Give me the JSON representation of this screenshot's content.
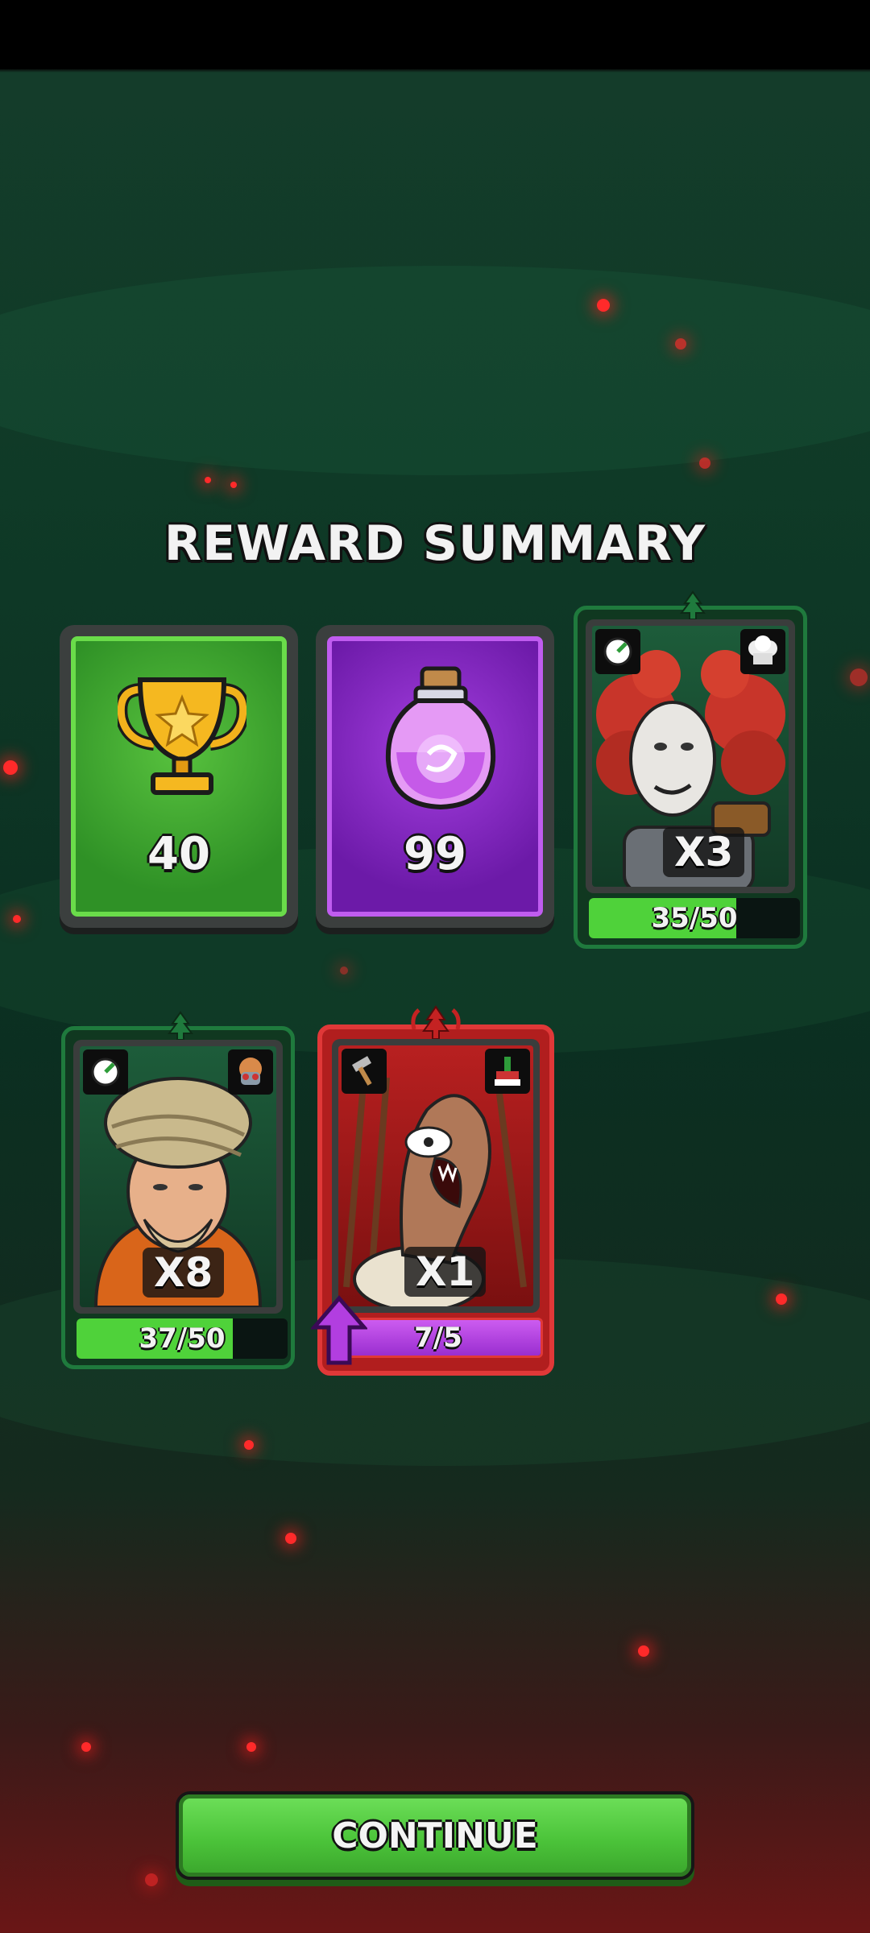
{
  "title": "REWARD SUMMARY",
  "rewards": [
    {
      "kind": "trophy",
      "icon": "trophy-icon",
      "amount": "40",
      "color": "#3fa42e"
    },
    {
      "kind": "potion",
      "icon": "potion-jar-icon",
      "amount": "99",
      "color": "#8e2fd0"
    }
  ],
  "heroes": [
    {
      "name": "red-haired-survivor",
      "multiplier": "X3",
      "progress_text": "35/50",
      "progress": 0.7,
      "rarity_color": "#1f7a3d",
      "left_icon": "speed-gauge-icon",
      "right_icon": "chef-hat-icon"
    },
    {
      "name": "turban-bearded-man",
      "multiplier": "X8",
      "progress_text": "37/50",
      "progress": 0.74,
      "rarity_color": "#1f7a3d",
      "left_icon": "speed-gauge-icon",
      "right_icon": "gas-mask-icon"
    },
    {
      "name": "turkey-monster",
      "multiplier": "X1",
      "progress_text": "7/5",
      "progress": 1.0,
      "rarity_color": "#c42222",
      "left_icon": "hammer-icon",
      "right_icon": "cake-icon",
      "upgrade_available": true
    }
  ],
  "continue_label": "CONTINUE",
  "colors": {
    "button_green": "#4cc43a",
    "hero_bar": "#4fd23a",
    "epic_bar": "#b23ee0"
  }
}
